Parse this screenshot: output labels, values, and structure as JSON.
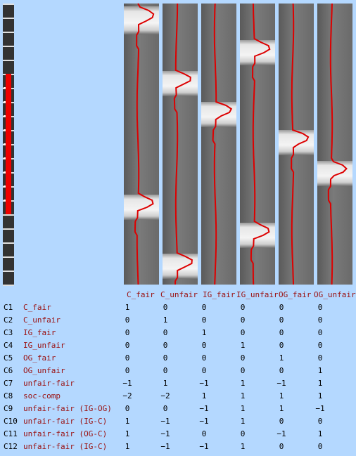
{
  "colors": {
    "background": "#b4d8ff",
    "regressor_line": "#dd0000",
    "label_text": "#9a1010",
    "value_text": "#000000",
    "active_scan_bar": "#ee0000"
  },
  "scan_strip": {
    "icon": "session-scan-strip",
    "active_range": [
      0.25,
      0.75
    ]
  },
  "columns": [
    {
      "label": "C_fair",
      "blocks": [
        [
          0.01,
          0.11
        ],
        [
          0.68,
          0.77
        ]
      ]
    },
    {
      "label": "C_unfair",
      "blocks": [
        [
          0.24,
          0.33
        ],
        [
          0.89,
          0.98
        ]
      ]
    },
    {
      "label": "IG_fair",
      "blocks": [
        [
          0.35,
          0.44
        ]
      ]
    },
    {
      "label": "IG_unfair",
      "blocks": [
        [
          0.13,
          0.22
        ],
        [
          0.78,
          0.87
        ]
      ]
    },
    {
      "label": "OG_fair",
      "blocks": [
        [
          0.45,
          0.54
        ]
      ]
    },
    {
      "label": "OG_unfair",
      "blocks": [
        [
          0.56,
          0.65
        ]
      ]
    }
  ],
  "contrasts": [
    {
      "id": "C1",
      "name": "C_fair",
      "weights": [
        "1",
        "0",
        "0",
        "0",
        "0",
        "0"
      ]
    },
    {
      "id": "C2",
      "name": "C_unfair",
      "weights": [
        "0",
        "1",
        "0",
        "0",
        "0",
        "0"
      ]
    },
    {
      "id": "C3",
      "name": "IG_fair",
      "weights": [
        "0",
        "0",
        "1",
        "0",
        "0",
        "0"
      ]
    },
    {
      "id": "C4",
      "name": "IG_unfair",
      "weights": [
        "0",
        "0",
        "0",
        "1",
        "0",
        "0"
      ]
    },
    {
      "id": "C5",
      "name": "OG_fair",
      "weights": [
        "0",
        "0",
        "0",
        "0",
        "1",
        "0"
      ]
    },
    {
      "id": "C6",
      "name": "OG_unfair",
      "weights": [
        "0",
        "0",
        "0",
        "0",
        "0",
        "1"
      ]
    },
    {
      "id": "C7",
      "name": "unfair-fair",
      "weights": [
        "-1",
        "1",
        "-1",
        "1",
        "-1",
        "1"
      ]
    },
    {
      "id": "C8",
      "name": "soc-comp",
      "weights": [
        "-2",
        "-2",
        "1",
        "1",
        "1",
        "1"
      ]
    },
    {
      "id": "C9",
      "name": "unfair-fair (IG-OG)",
      "weights": [
        "0",
        "0",
        "-1",
        "1",
        "1",
        "-1"
      ]
    },
    {
      "id": "C10",
      "name": "unfair-fair (IG-C)",
      "weights": [
        "1",
        "-1",
        "-1",
        "1",
        "0",
        "0"
      ]
    },
    {
      "id": "C11",
      "name": "unfair-fair (OG-C)",
      "weights": [
        "1",
        "-1",
        "0",
        "0",
        "-1",
        "1"
      ]
    },
    {
      "id": "C12",
      "name": "unfair-fair (IG-C)",
      "weights": [
        "1",
        "-1",
        "-1",
        "1",
        "0",
        "0"
      ]
    }
  ]
}
